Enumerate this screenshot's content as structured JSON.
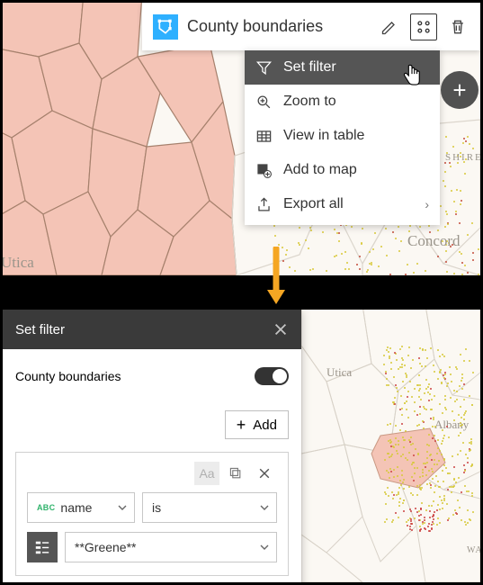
{
  "layer": {
    "title": "County boundaries"
  },
  "menu": {
    "set_filter": "Set filter",
    "zoom_to": "Zoom to",
    "view_table": "View in table",
    "add_to_map": "Add to map",
    "export_all": "Export all"
  },
  "map_labels_top": {
    "concord": "Concord",
    "utica": "Utica",
    "shire": "SHIRE"
  },
  "arrow_color": "#f5a623",
  "filter_dialog": {
    "title": "Set filter",
    "layer_name": "County boundaries",
    "add_label": "Add",
    "abc_label": "ABC",
    "field": "name",
    "operator": "is",
    "value": "**Greene**",
    "aa_label": "Aa"
  },
  "map_labels_bottom": {
    "utica": "Utica",
    "albany": "Albany",
    "wa": "WA"
  }
}
